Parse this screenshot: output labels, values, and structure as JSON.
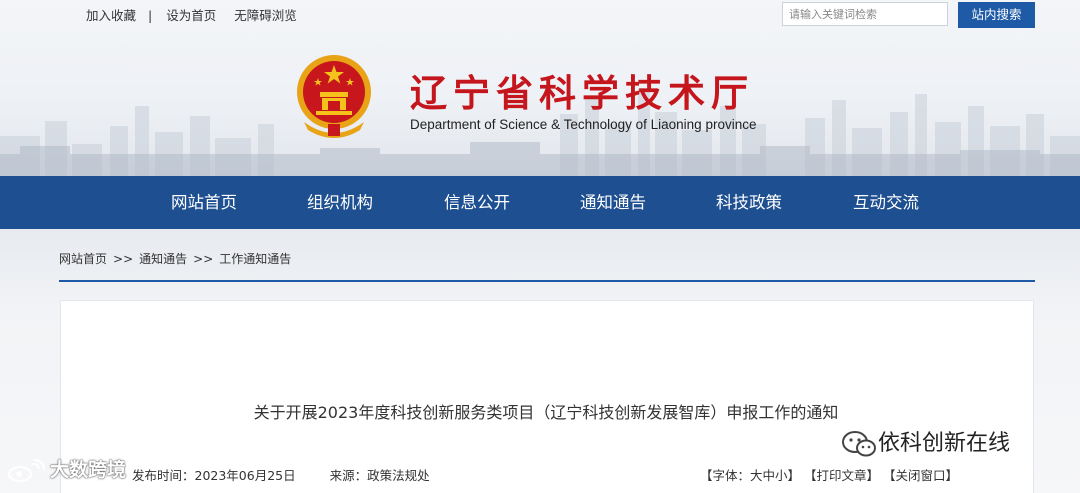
{
  "top_bar": {
    "links": [
      "加入收藏",
      "设为首页",
      "无障碍浏览"
    ],
    "separator": "|",
    "search_placeholder": "请输入关键词检索",
    "search_button": "站内搜索"
  },
  "brand": {
    "title": "辽宁省科学技术厅",
    "subtitle": "Department of Science & Technology of Liaoning province",
    "emblem_icon": "national-emblem-icon",
    "title_color": "#c4161c"
  },
  "nav": {
    "items": [
      "网站首页",
      "组织机构",
      "信息公开",
      "通知通告",
      "科技政策",
      "互动交流"
    ],
    "background": "#1d4f91"
  },
  "breadcrumb": {
    "items": [
      "网站首页",
      "通知通告",
      "工作通知通告"
    ],
    "separator": ">>"
  },
  "article": {
    "title": "关于开展2023年度科技创新服务类项目（辽宁科技创新发展智库）申报工作的通知",
    "publish_time": "发布时间：2023年06月25日",
    "source": "来源：政策法规处",
    "tools": [
      "【字体：大中小】",
      "【打印文章】",
      "【关闭窗口】"
    ]
  },
  "watermarks": {
    "left_text": "大数跨境",
    "right_text": "依科创新在线",
    "left_icon": "weibo-icon",
    "right_icon": "wechat-icon"
  },
  "colors": {
    "accent": "#1f5aa6",
    "nav": "#1d4f91"
  }
}
